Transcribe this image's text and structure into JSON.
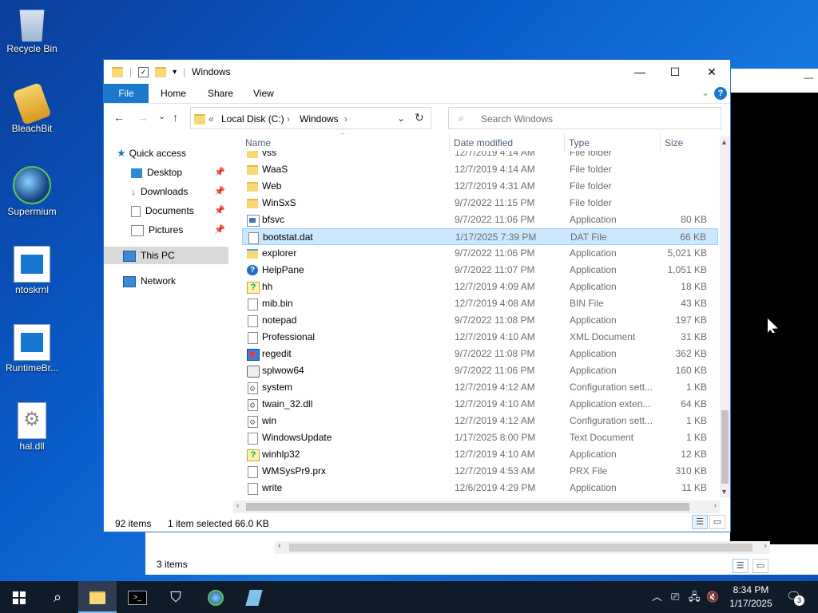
{
  "desktop": {
    "icons": [
      {
        "label": "Recycle Bin"
      },
      {
        "label": "BleachBit"
      },
      {
        "label": "Supermium"
      },
      {
        "label": "ntoskrnl"
      },
      {
        "label": "RuntimeBr..."
      },
      {
        "label": "hal.dll"
      }
    ]
  },
  "bg_window": {
    "status": "3 items"
  },
  "window": {
    "title": "Windows",
    "controls": {
      "minimize": "—",
      "maximize": "☐",
      "close": "✕"
    },
    "ribbon": {
      "file": "File",
      "tabs": [
        "Home",
        "Share",
        "View"
      ],
      "help": "?"
    },
    "nav": {
      "back": "←",
      "forward": "→",
      "recent": "⌄",
      "up": "↑"
    },
    "address": {
      "prefix": "«",
      "segments": [
        "Local Disk (C:)",
        "Windows"
      ],
      "sep": "›"
    },
    "search": {
      "placeholder": "Search Windows"
    },
    "navpane": {
      "quick_access": "Quick access",
      "items": [
        {
          "label": "Desktop",
          "pinned": true
        },
        {
          "label": "Downloads",
          "pinned": true
        },
        {
          "label": "Documents",
          "pinned": true
        },
        {
          "label": "Pictures",
          "pinned": true
        }
      ],
      "this_pc": "This PC",
      "network": "Network"
    },
    "columns": {
      "name": "Name",
      "date": "Date modified",
      "type": "Type",
      "size": "Size"
    },
    "files": [
      {
        "name": "vss",
        "date": "12/7/2019 4:14 AM",
        "type": "File folder",
        "size": "",
        "icon": "folder"
      },
      {
        "name": "WaaS",
        "date": "12/7/2019 4:14 AM",
        "type": "File folder",
        "size": "",
        "icon": "folder"
      },
      {
        "name": "Web",
        "date": "12/7/2019 4:31 AM",
        "type": "File folder",
        "size": "",
        "icon": "folder"
      },
      {
        "name": "WinSxS",
        "date": "9/7/2022 11:15 PM",
        "type": "File folder",
        "size": "",
        "icon": "folder"
      },
      {
        "name": "bfsvc",
        "date": "9/7/2022 11:06 PM",
        "type": "Application",
        "size": "80 KB",
        "icon": "app"
      },
      {
        "name": "bootstat.dat",
        "date": "1/17/2025 7:39 PM",
        "type": "DAT File",
        "size": "66 KB",
        "icon": "doc",
        "selected": true
      },
      {
        "name": "explorer",
        "date": "9/7/2022 11:06 PM",
        "type": "Application",
        "size": "5,021 KB",
        "icon": "explorer"
      },
      {
        "name": "HelpPane",
        "date": "9/7/2022 11:07 PM",
        "type": "Application",
        "size": "1,051 KB",
        "icon": "help"
      },
      {
        "name": "hh",
        "date": "12/7/2019 4:09 AM",
        "type": "Application",
        "size": "18 KB",
        "icon": "helpy"
      },
      {
        "name": "mib.bin",
        "date": "12/7/2019 4:08 AM",
        "type": "BIN File",
        "size": "43 KB",
        "icon": "doc"
      },
      {
        "name": "notepad",
        "date": "9/7/2022 11:08 PM",
        "type": "Application",
        "size": "197 KB",
        "icon": "doc"
      },
      {
        "name": "Professional",
        "date": "12/7/2019 4:10 AM",
        "type": "XML Document",
        "size": "31 KB",
        "icon": "doc"
      },
      {
        "name": "regedit",
        "date": "9/7/2022 11:08 PM",
        "type": "Application",
        "size": "362 KB",
        "icon": "reg"
      },
      {
        "name": "splwow64",
        "date": "9/7/2022 11:06 PM",
        "type": "Application",
        "size": "160 KB",
        "icon": "print"
      },
      {
        "name": "system",
        "date": "12/7/2019 4:12 AM",
        "type": "Configuration sett...",
        "size": "1 KB",
        "icon": "gear"
      },
      {
        "name": "twain_32.dll",
        "date": "12/7/2019 4:10 AM",
        "type": "Application exten...",
        "size": "64 KB",
        "icon": "gear"
      },
      {
        "name": "win",
        "date": "12/7/2019 4:12 AM",
        "type": "Configuration sett...",
        "size": "1 KB",
        "icon": "gear"
      },
      {
        "name": "WindowsUpdate",
        "date": "1/17/2025 8:00 PM",
        "type": "Text Document",
        "size": "1 KB",
        "icon": "doc"
      },
      {
        "name": "winhlp32",
        "date": "12/7/2019 4:10 AM",
        "type": "Application",
        "size": "12 KB",
        "icon": "helpy"
      },
      {
        "name": "WMSysPr9.prx",
        "date": "12/7/2019 4:53 AM",
        "type": "PRX File",
        "size": "310 KB",
        "icon": "doc"
      },
      {
        "name": "write",
        "date": "12/6/2019 4:29 PM",
        "type": "Application",
        "size": "11 KB",
        "icon": "doc"
      }
    ],
    "status": {
      "count": "92 items",
      "selected": "1 item selected",
      "size": "66.0 KB"
    }
  },
  "taskbar": {
    "clock_time": "8:34 PM",
    "clock_date": "1/17/2025",
    "notification_count": "3"
  },
  "colors": {
    "accent": "#1979ca",
    "selection": "#cce8ff",
    "taskbar": "#101b2a"
  }
}
